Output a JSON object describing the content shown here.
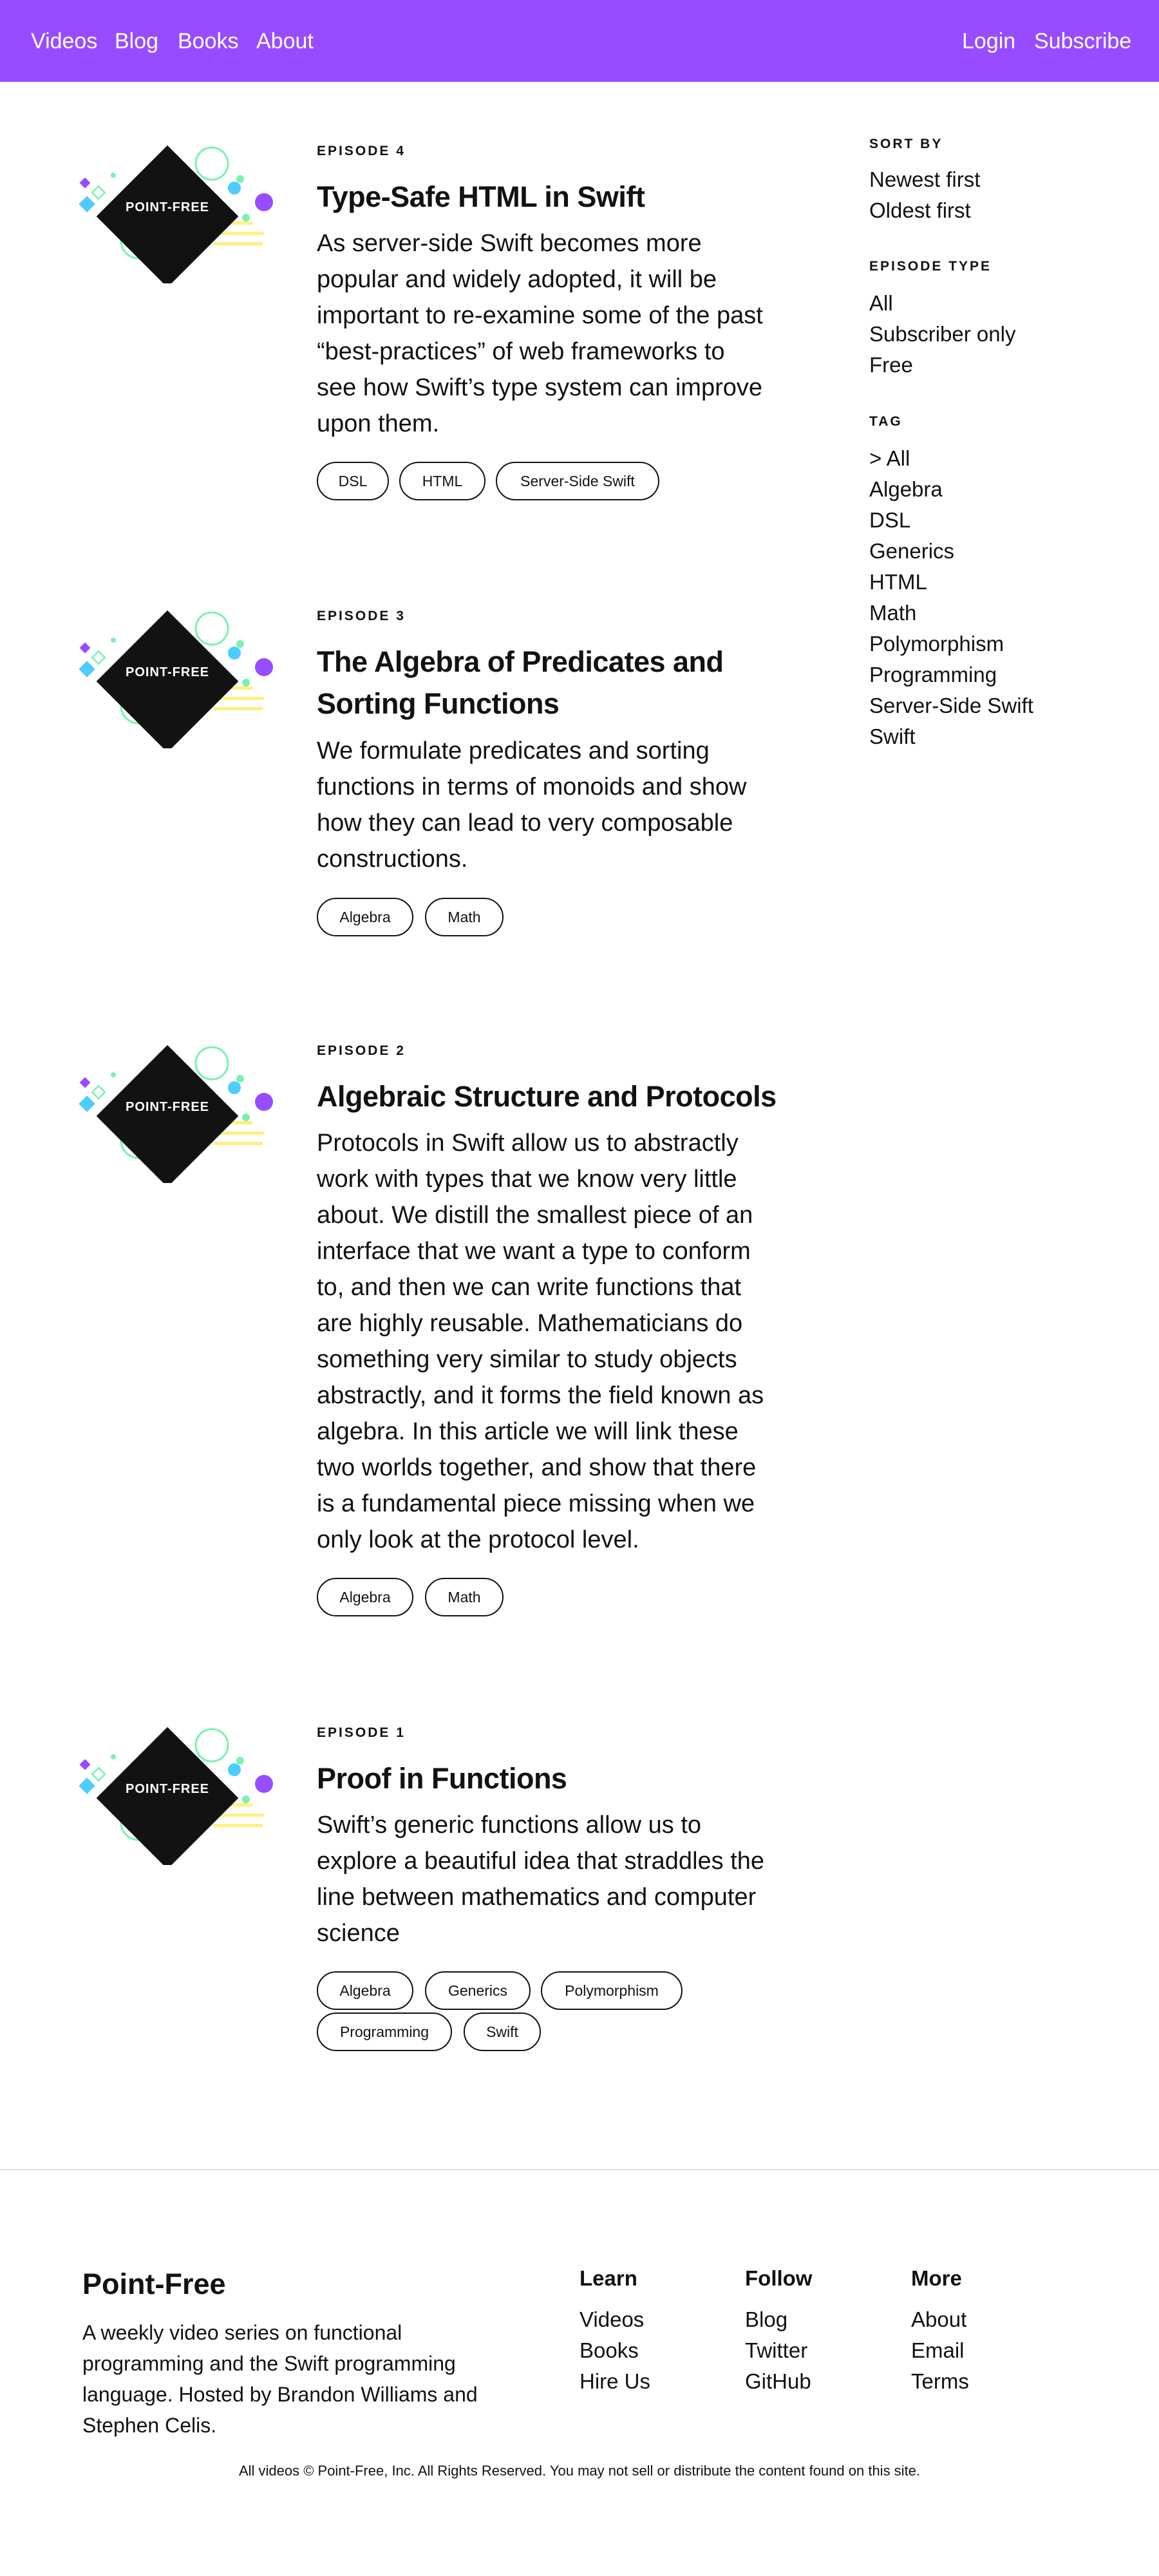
{
  "nav": {
    "left": [
      "Videos",
      "Blog",
      "Books",
      "About"
    ],
    "right": [
      "Login",
      "Subscribe"
    ]
  },
  "colors": {
    "brand": "#974dff",
    "text": "#121212",
    "mint": "#79f2b0",
    "blue": "#4cccff",
    "yellow": "#fff080"
  },
  "thumbnail_logo": "POINT-FREE",
  "episodes": [
    {
      "number": "EPISODE 4",
      "title_lines": [
        "Type-Safe HTML in Swift"
      ],
      "blurb_lines": [
        "As server-side Swift becomes more",
        "popular and widely adopted, it will be",
        "important to re-examine some of the past",
        "“best-practices” of web frameworks to",
        "see how Swift’s type system can improve",
        "upon them."
      ],
      "tags": [
        "DSL",
        "HTML",
        "Server-Side Swift"
      ]
    },
    {
      "number": "EPISODE 3",
      "title_lines": [
        "The Algebra of Predicates and",
        "Sorting Functions"
      ],
      "blurb_lines": [
        "We formulate predicates and sorting",
        "functions in terms of monoids and show",
        "how they can lead to very composable",
        "constructions."
      ],
      "tags": [
        "Algebra",
        "Math"
      ]
    },
    {
      "number": "EPISODE 2",
      "title_lines": [
        "Algebraic Structure and Protocols"
      ],
      "blurb_lines": [
        "Protocols in Swift allow us to abstractly",
        "work with types that we know very little",
        "about. We distill the smallest piece of an",
        "interface that we want a type to conform",
        "to, and then we can write functions that",
        "are highly reusable. Mathematicians do",
        "something very similar to study objects",
        "abstractly, and it forms the field known as",
        "algebra. In this article we will link these",
        "two worlds together, and show that there",
        "is a fundamental piece missing when we",
        "only look at the protocol level."
      ],
      "tags": [
        "Algebra",
        "Math"
      ]
    },
    {
      "number": "EPISODE 1",
      "title_lines": [
        "Proof in Functions"
      ],
      "blurb_lines": [
        "Swift’s generic functions allow us to",
        "explore a beautiful idea that straddles the",
        "line between mathematics and computer",
        "science"
      ],
      "tags": [
        "Algebra",
        "Generics",
        "Polymorphism",
        "Programming",
        "Swift"
      ]
    }
  ],
  "sidebar": {
    "sort_by": {
      "heading": "SORT BY",
      "items": [
        "Newest first",
        "Oldest first"
      ]
    },
    "episode_type": {
      "heading": "EPISODE TYPE",
      "items": [
        "All",
        "Subscriber only",
        "Free"
      ]
    },
    "tag": {
      "heading": "TAG",
      "items": [
        "> All",
        "Algebra",
        "DSL",
        "Generics",
        "HTML",
        "Math",
        "Polymorphism",
        "Programming",
        "Server-Side Swift",
        "Swift"
      ]
    }
  },
  "footer": {
    "brand": "Point-Free",
    "description": "A weekly video series on functional programming and the Swift programming language. Hosted by Brandon Williams and Stephen Celis.",
    "columns": [
      {
        "heading": "Learn",
        "links": [
          "Videos",
          "Books",
          "Hire Us"
        ]
      },
      {
        "heading": "Follow",
        "links": [
          "Blog",
          "Twitter",
          "GitHub"
        ]
      },
      {
        "heading": "More",
        "links": [
          "About",
          "Email",
          "Terms"
        ]
      }
    ],
    "copyright": "All videos © Point-Free, Inc. All Rights Reserved. You may not sell or distribute the content found on this site."
  }
}
